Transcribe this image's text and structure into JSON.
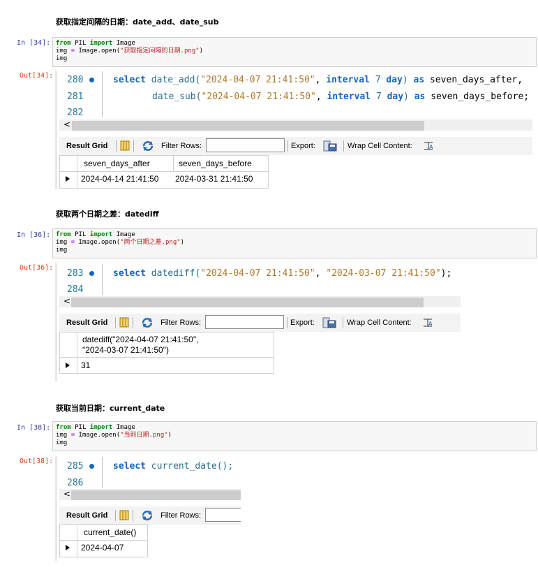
{
  "sections": [
    {
      "heading": "获取指定间隔的日期：date_add、date_sub",
      "in_prompt": "In  [34]:",
      "out_prompt": "Out[34]:",
      "code": {
        "line1_kw1": "from",
        "line1_mod": " PIL ",
        "line1_kw2": "import",
        "line1_name": " Image",
        "line2_a": "img ",
        "line2_eq": "=",
        "line2_b": " Image.open(",
        "line2_str": "\"获取指定间隔的日期.png\"",
        "line2_c": ")",
        "line3": "img"
      },
      "sql_lines": [
        {
          "no": "280",
          "parts": [
            "select",
            " date_add(",
            "\"2024-04-07 21:41:50\"",
            ", ",
            "interval",
            " ",
            "7",
            " ",
            "day",
            ") ",
            "as",
            " seven_days_after,"
          ]
        },
        {
          "no": "281",
          "parts": [
            "date_sub(",
            "\"2024-04-07 21:41:50\"",
            ", ",
            "interval",
            " ",
            "7",
            " ",
            "day",
            ") ",
            "as",
            " seven_days_before;"
          ]
        },
        {
          "no": "282"
        }
      ],
      "columns": [
        "seven_days_after",
        "seven_days_before"
      ],
      "row": [
        "2024-04-14 21:41:50",
        "2024-03-31 21:41:50"
      ]
    },
    {
      "heading": "获取两个日期之差：datediff",
      "in_prompt": "In  [36]:",
      "out_prompt": "Out[36]:",
      "code": {
        "line1_kw1": "from",
        "line1_mod": " PIL ",
        "line1_kw2": "import",
        "line1_name": " Image",
        "line2_a": "img ",
        "line2_eq": "=",
        "line2_b": " Image.open(",
        "line2_str": "\"两个日期之差.png\"",
        "line2_c": ")",
        "line3": "img"
      },
      "sql_lines": [
        {
          "no": "283",
          "parts": [
            "select",
            " datediff(",
            "\"2024-04-07 21:41:50\"",
            ", ",
            "\"2024-03-07 21:41:50\"",
            ");"
          ]
        },
        {
          "no": "284"
        }
      ],
      "columns": [
        "datediff(\"2024-04-07 21:41:50\",",
        "\"2024-03-07 21:41:50\")"
      ],
      "row": [
        "31"
      ]
    },
    {
      "heading": "获取当前日期：current_date",
      "in_prompt": "In  [38]:",
      "out_prompt": "Out[38]:",
      "code": {
        "line1_kw1": "from",
        "line1_mod": " PIL ",
        "line1_kw2": "import",
        "line1_name": " Image",
        "line2_a": "img ",
        "line2_eq": "=",
        "line2_b": " Image.open(",
        "line2_str": "\"当前日期.png\"",
        "line2_c": ")",
        "line3": "img"
      },
      "sql_lines": [
        {
          "no": "285",
          "parts": [
            "select",
            " current_date();"
          ]
        },
        {
          "no": "286"
        }
      ],
      "columns": [
        "current_date()"
      ],
      "row": [
        "2024-04-07"
      ]
    }
  ],
  "toolbar": {
    "result_grid": "Result Grid",
    "filter_rows": "Filter Rows:",
    "export": "Export:",
    "wrap": "Wrap Cell Content:"
  },
  "icons": {
    "grid": "grid-layout-icon",
    "refresh": "refresh-icon",
    "export": "export-disk-icon",
    "wrap": "wrap-text-icon",
    "scroll_left": "scroll-left-arrow-icon",
    "row_marker": "row-pointer-icon"
  },
  "scroll_left_glyph": "<",
  "colors": {
    "prompt_in": "#303f9f",
    "prompt_out": "#d84315",
    "sql_keyword": "#1565c0",
    "sql_string": "#b07a2a"
  }
}
